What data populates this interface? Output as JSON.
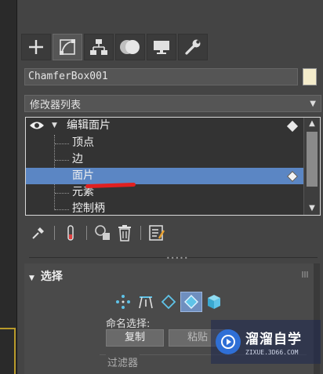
{
  "panel": {
    "tabs": [
      {
        "icon": "plus-icon",
        "active": false
      },
      {
        "icon": "modify-curve-icon",
        "active": true
      },
      {
        "icon": "hierarchy-icon",
        "active": false
      },
      {
        "icon": "motion-icon",
        "active": false
      },
      {
        "icon": "display-icon",
        "active": false
      },
      {
        "icon": "wrench-icon",
        "active": false
      }
    ],
    "object_name": "ChamferBox001",
    "object_color": "#f4eccb",
    "modifier_list": "修改器列表"
  },
  "stack": {
    "root": "编辑面片",
    "children": [
      "顶点",
      "边",
      "面片",
      "元素",
      "控制柄"
    ],
    "selected": "面片",
    "selection_color": "#5b86c4"
  },
  "selection_rollout": {
    "title": "选择",
    "named_selection_label": "命名选择:",
    "copy_label": "复制",
    "paste_label": "粘贴",
    "filter_label": "过滤器"
  },
  "watermark": {
    "title": "溜溜自学",
    "url": "ZIXUE.3D66.COM"
  }
}
